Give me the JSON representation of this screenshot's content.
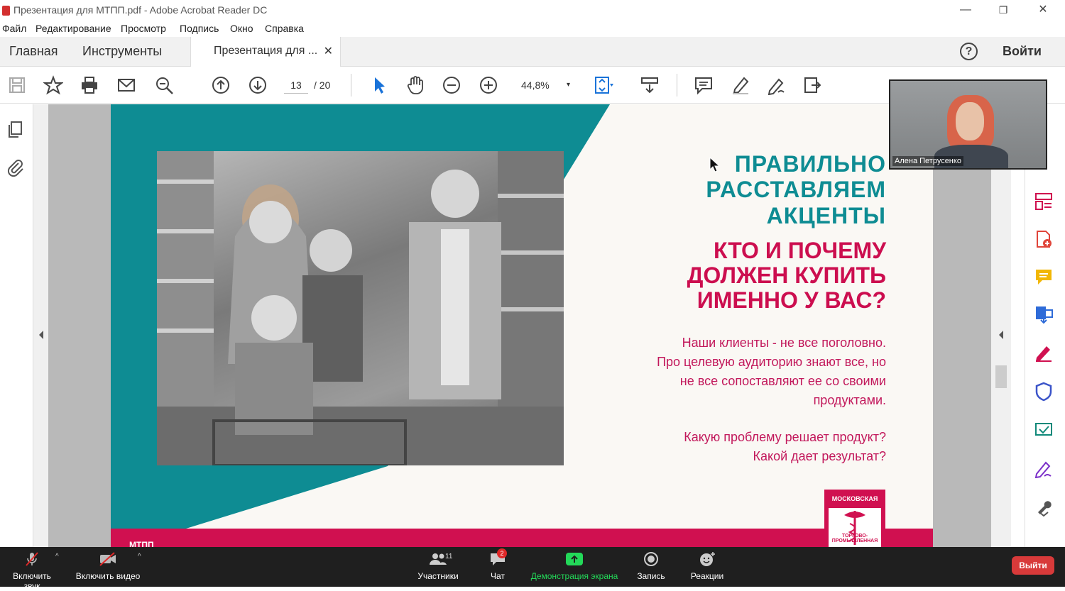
{
  "window": {
    "title": "Презентация для МТПП.pdf - Adobe Acrobat Reader DC",
    "controls": {
      "minimize": "—",
      "restore": "❐",
      "close": "✕"
    }
  },
  "menu": [
    "Файл",
    "Редактирование",
    "Просмотр",
    "Подпись",
    "Окно",
    "Справка"
  ],
  "tabs": {
    "home": "Главная",
    "tools": "Инструменты",
    "doc": "Презентация для ...",
    "close": "✕",
    "help": "?",
    "login": "Войти"
  },
  "toolbar": {
    "page_current": "13",
    "page_total": "/ 20",
    "zoom": "44,8%",
    "zoom_caret": "▾"
  },
  "slide": {
    "heading1": [
      "ПРАВИЛЬНО",
      "РАССТАВЛЯЕМ",
      "АКЦЕНТЫ"
    ],
    "heading2": [
      "КТО И ПОЧЕМУ",
      "ДОЛЖЕН КУПИТЬ",
      "ИМЕННО У ВАС?"
    ],
    "para1": [
      "Наши клиенты - не все поголовно.",
      "Про целевую аудиторию знают все, но",
      "не все сопоставляют ее со своими",
      "продуктами."
    ],
    "para2": [
      "Какую проблему решает продукт?",
      "Какой дает результат?"
    ],
    "footer_label": "МТПП",
    "logo_top": "МОСКОВСКАЯ",
    "logo_bottom": "ТОРГОВО-ПРОМЫШЛЕННАЯ"
  },
  "video": {
    "participant_name": "Алена Петрусенко"
  },
  "zoombar": {
    "audio": "Включить звук",
    "video": "Включить видео",
    "participants": "Участники",
    "participants_count": "11",
    "chat": "Чат",
    "chat_badge": "2",
    "share": "Демонстрация экрана",
    "record": "Запись",
    "reactions": "Реакции",
    "leave": "Выйти",
    "caret": "^"
  },
  "colors": {
    "teal": "#0e8c93",
    "crimson": "#cc0e4f",
    "share_green": "#23d959"
  }
}
